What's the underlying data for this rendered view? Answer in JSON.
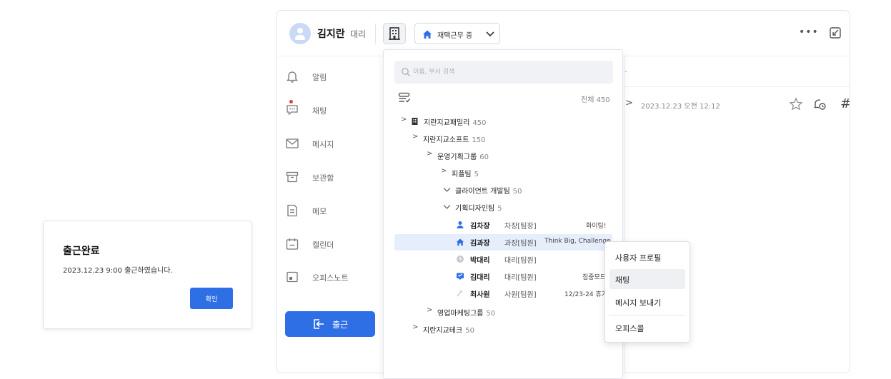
{
  "toast": {
    "title": "출근완료",
    "message": "2023.12.23 9:00 출근하였습니다.",
    "confirm_label": "확인"
  },
  "header": {
    "user_name": "김지란",
    "user_title": "대리",
    "status_label": "재택근무 중",
    "more_label": "•••"
  },
  "sidebar": {
    "items": [
      {
        "label": "알림",
        "icon": "bell-icon"
      },
      {
        "label": "채팅",
        "icon": "chat-icon"
      },
      {
        "label": "메시지",
        "icon": "mail-icon"
      },
      {
        "label": "보관함",
        "icon": "archive-icon"
      },
      {
        "label": "메모",
        "icon": "memo-icon"
      },
      {
        "label": "캘린더",
        "icon": "calendar-icon"
      },
      {
        "label": "오피스노트",
        "icon": "note-icon"
      }
    ],
    "checkout_label": "출근"
  },
  "main": {
    "dash": "-",
    "date": "2023.12.23 오전 12:12",
    "hash": "#"
  },
  "org": {
    "search_placeholder": "이름, 부서 검색",
    "total_label": "전체 450",
    "tree": [
      {
        "name": "지란지교패밀리",
        "count": "450"
      },
      {
        "name": "지란지교소프트",
        "count": "150"
      },
      {
        "name": "운영기획그룹",
        "count": "60"
      },
      {
        "name": "피플팀",
        "count": "5"
      },
      {
        "name": "클라이언트 개발팀",
        "count": "50"
      },
      {
        "name": "기획디자인팀",
        "count": "5"
      },
      {
        "name": "영업마케팅그룹",
        "count": "50"
      },
      {
        "name": "지란지교테크",
        "count": "50"
      }
    ],
    "members": [
      {
        "name": "김차장",
        "role": "차장[팀장]",
        "status": "화이팅!"
      },
      {
        "name": "김과장",
        "role": "과장[팀원]",
        "status": "Think Big, Challenge"
      },
      {
        "name": "박대리",
        "role": "대리[팀원]",
        "status": ""
      },
      {
        "name": "김대리",
        "role": "대리[팀원]",
        "status": "집중모드"
      },
      {
        "name": "최사원",
        "role": "사원[팀원]",
        "status": "12/23-24 휴가"
      }
    ]
  },
  "context_menu": {
    "items": [
      "사용자 프로필",
      "채팅",
      "메시지 보내기",
      "오피스콜"
    ]
  },
  "colors": {
    "accent": "#2f6fe6",
    "selected_row": "#e6eefc",
    "unread_dot": "#e33d3d"
  }
}
